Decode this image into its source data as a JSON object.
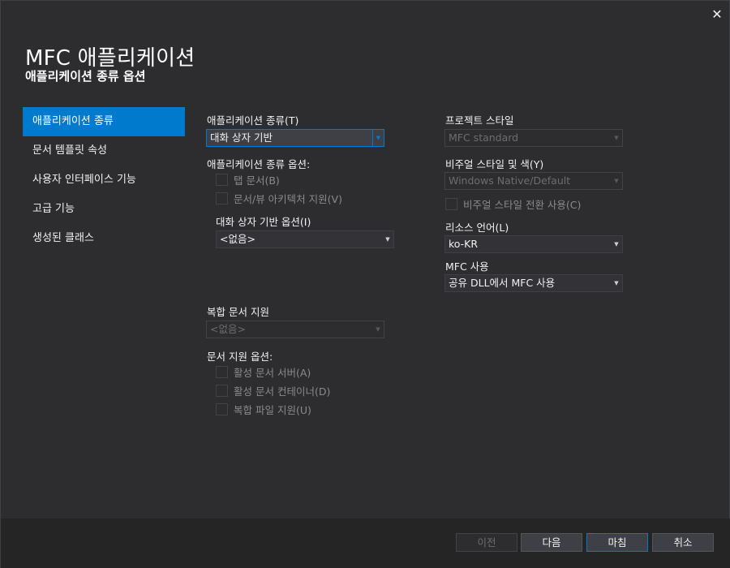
{
  "window": {
    "title": "MFC 애플리케이션",
    "subtitle": "애플리케이션 종류 옵션",
    "close_glyph": "✕"
  },
  "nav": {
    "items": [
      {
        "label": "애플리케이션 종류"
      },
      {
        "label": "문서 템플릿 속성"
      },
      {
        "label": "사용자 인터페이스 기능"
      },
      {
        "label": "고급 기능"
      },
      {
        "label": "생성된 클래스"
      }
    ],
    "active_index": 0
  },
  "app_type": {
    "label": "애플리케이션 종류(T)",
    "value": "대화 상자 기반",
    "options_label": "애플리케이션 종류 옵션:",
    "tabbed_docs": {
      "label": "탭 문서(B)",
      "checked": false
    },
    "doc_view": {
      "label": "문서/뷰 아키텍처 지원(V)",
      "checked": false
    },
    "dialog_options_label": "대화 상자 기반 옵션(I)",
    "dialog_options_value": "<없음>"
  },
  "compound": {
    "label": "복합 문서 지원",
    "value": "<없음>"
  },
  "doc_support": {
    "label": "문서 지원 옵션:",
    "active_server": {
      "label": "활성 문서 서버(A)",
      "checked": false
    },
    "active_container": {
      "label": "활성 문서 컨테이너(D)",
      "checked": false
    },
    "compound_file": {
      "label": "복합 파일 지원(U)",
      "checked": false
    }
  },
  "project_style": {
    "label": "프로젝트 스타일",
    "value": "MFC standard"
  },
  "visual_style": {
    "label": "비주얼 스타일 및 색(Y)",
    "value": "Windows Native/Default",
    "toggle": {
      "label": "비주얼 스타일 전환 사용(C)",
      "checked": false
    }
  },
  "resource_lang": {
    "label": "리소스 언어(L)",
    "value": "ko-KR"
  },
  "mfc_use": {
    "label": "MFC 사용",
    "value": "공유 DLL에서 MFC 사용"
  },
  "buttons": {
    "prev": "이전",
    "next": "다음",
    "finish": "마침",
    "cancel": "취소"
  },
  "colors": {
    "background": "#2d2d30",
    "accent": "#007acc",
    "footer": "#252526"
  },
  "icons": {
    "close": "close-icon",
    "dropdown": "chevron-down-icon"
  }
}
